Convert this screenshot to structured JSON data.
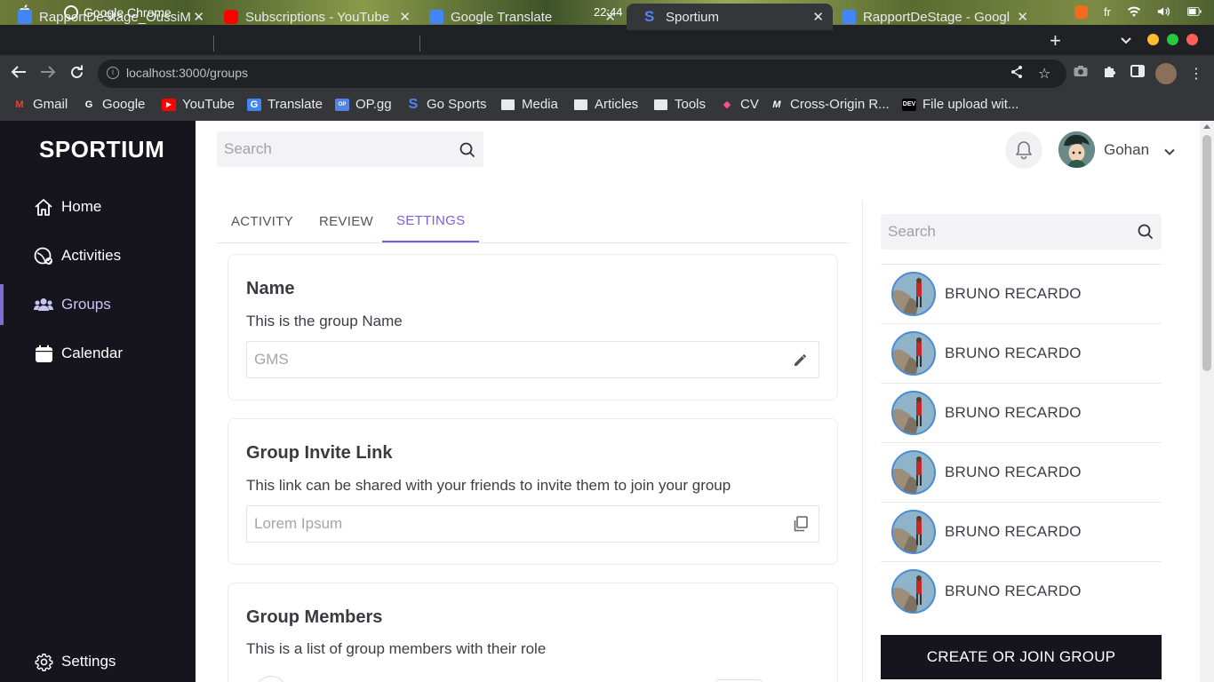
{
  "os": {
    "app_name": "Google Chrome",
    "time": "22:44",
    "lang": "fr"
  },
  "browser": {
    "tabs": [
      {
        "title": "RapportDeStage_OussiM",
        "favicon": "google-docs-icon"
      },
      {
        "title": "Subscriptions - YouTube",
        "favicon": "youtube-icon"
      },
      {
        "title": "Google Translate",
        "favicon": "translate-icon"
      },
      {
        "title": "Sportium",
        "favicon": "sportium-icon"
      },
      {
        "title": "RapportDeStage - Googl",
        "favicon": "google-docs-icon"
      }
    ],
    "active_tab": 3,
    "url": "localhost:3000/groups",
    "bookmarks": [
      {
        "label": "Gmail",
        "icon": "gmail-icon"
      },
      {
        "label": "Google",
        "icon": "google-icon"
      },
      {
        "label": "YouTube",
        "icon": "youtube-icon"
      },
      {
        "label": "Translate",
        "icon": "translate-icon"
      },
      {
        "label": "OP.gg",
        "icon": "opgg-icon"
      },
      {
        "label": "Go Sports",
        "icon": "sportium-icon"
      },
      {
        "label": "Media",
        "icon": "folder-icon"
      },
      {
        "label": "Articles",
        "icon": "folder-icon"
      },
      {
        "label": "Tools",
        "icon": "folder-icon"
      },
      {
        "label": "CV",
        "icon": "cv-icon"
      },
      {
        "label": "Cross-Origin R...",
        "icon": "mdn-icon"
      },
      {
        "label": "File upload wit...",
        "icon": "dev-icon"
      }
    ]
  },
  "sidebar": {
    "logo": "SPORTIUM",
    "items": [
      {
        "label": "Home",
        "icon": "home-icon"
      },
      {
        "label": "Activities",
        "icon": "activities-icon"
      },
      {
        "label": "Groups",
        "icon": "groups-icon"
      },
      {
        "label": "Calendar",
        "icon": "calendar-icon"
      }
    ],
    "active": "Groups",
    "settings_label": "Settings"
  },
  "header": {
    "search_placeholder": "Search",
    "user_name": "Gohan"
  },
  "tabs": {
    "items": [
      "ACTIVITY",
      "REVIEW",
      "SETTINGS"
    ],
    "active": "SETTINGS"
  },
  "cards": {
    "name": {
      "title": "Name",
      "description": "This is the group Name",
      "placeholder": "GMS"
    },
    "invite": {
      "title": "Group Invite Link",
      "description": "This link can be shared with your friends to invite them to join your group",
      "placeholder": "Lorem Ipsum"
    },
    "members": {
      "title": "Group Members",
      "description": "This is a list of group members with their role"
    }
  },
  "right_panel": {
    "search_placeholder": "Search",
    "members": [
      {
        "name": "BRUNO RECARDO"
      },
      {
        "name": "BRUNO RECARDO"
      },
      {
        "name": "BRUNO RECARDO"
      },
      {
        "name": "BRUNO RECARDO"
      },
      {
        "name": "BRUNO RECARDO"
      },
      {
        "name": "BRUNO RECARDO"
      }
    ],
    "cta_label": "CREATE OR JOIN GROUP"
  },
  "colors": {
    "accent": "#7c5ce0",
    "sidebar_bg": "#16151d",
    "sidebar_active_bar": "#7b6fd0"
  }
}
